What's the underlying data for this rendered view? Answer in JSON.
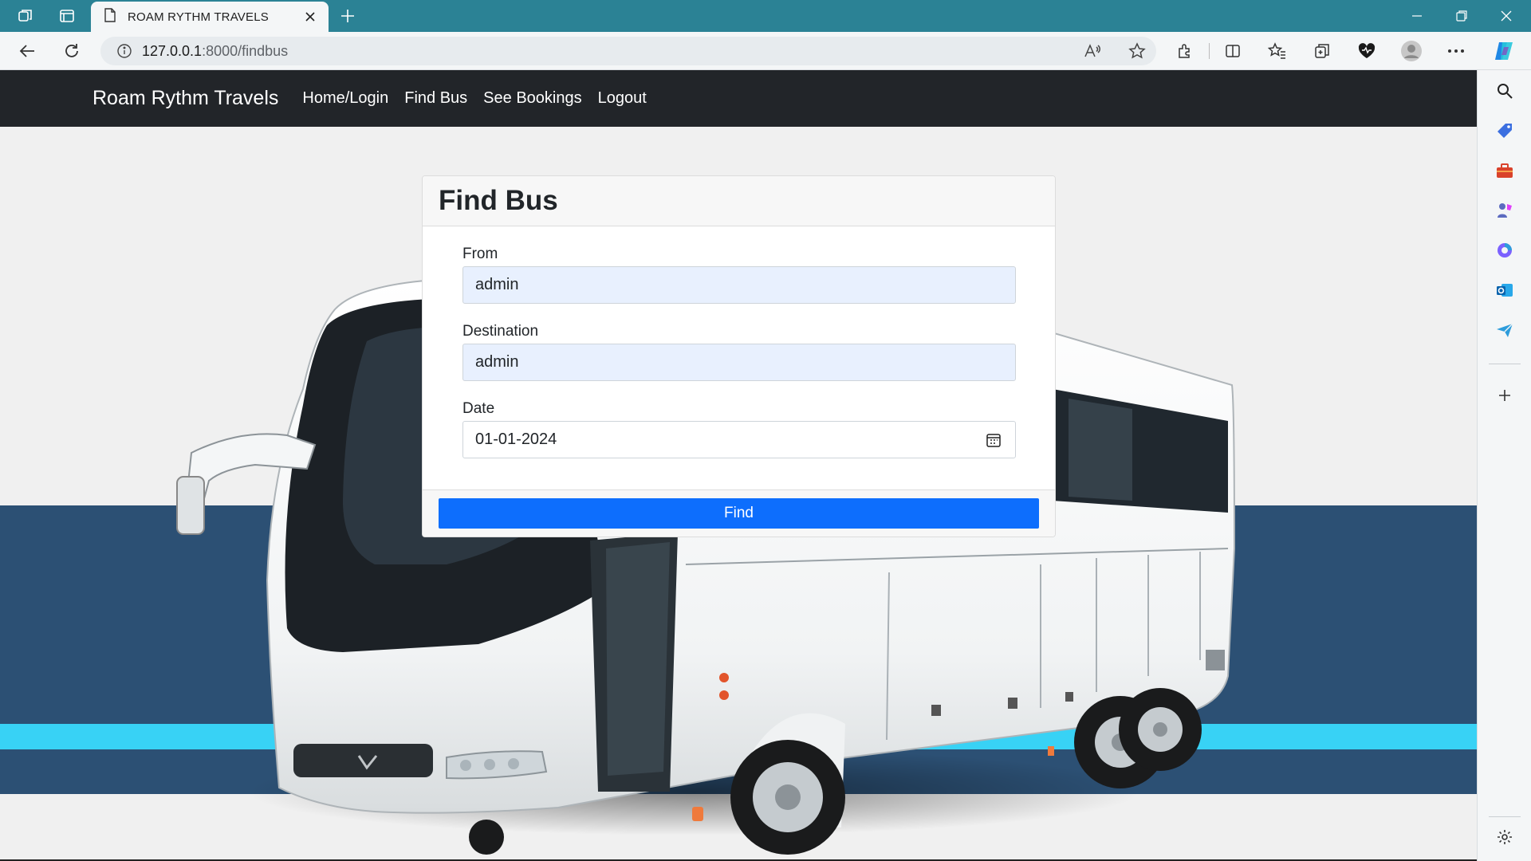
{
  "browser": {
    "tab_title": "ROAM RYTHM TRAVELS",
    "url_host": "127.0.0.1",
    "url_rest": ":8000/findbus",
    "icons": [
      "workspaces-icon",
      "tab-actions-icon",
      "page-icon",
      "close-icon",
      "plus-icon",
      "minimize-icon",
      "restore-icon",
      "window-close-icon",
      "back-icon",
      "refresh-icon",
      "info-icon",
      "read-aloud-icon",
      "favorite-star-icon",
      "extensions-icon",
      "split-screen-icon",
      "favorites-icon",
      "collections-icon",
      "browser-essentials-icon",
      "profile-icon",
      "more-icon",
      "copilot-icon"
    ]
  },
  "sidebar": {
    "icons": [
      "search-icon",
      "shopping-tag-icon",
      "tools-icon",
      "games-icon",
      "microsoft365-icon",
      "outlook-icon",
      "send-icon",
      "add-icon",
      "settings-icon"
    ]
  },
  "navbar": {
    "brand": "Roam Rythm Travels",
    "links": [
      "Home/Login",
      "Find Bus",
      "See Bookings",
      "Logout"
    ]
  },
  "form": {
    "title": "Find Bus",
    "from_label": "From",
    "from_value": "admin",
    "destination_label": "Destination",
    "destination_value": "admin",
    "date_label": "Date",
    "date_value": "01-01-2024",
    "submit_label": "Find"
  },
  "colors": {
    "tabbar": "#2b8295",
    "navbar": "#222529",
    "button": "#0d6efd",
    "band_blue": "#2c5074",
    "band_cyan": "#38d2f5",
    "autofill": "#e8f0fe"
  }
}
